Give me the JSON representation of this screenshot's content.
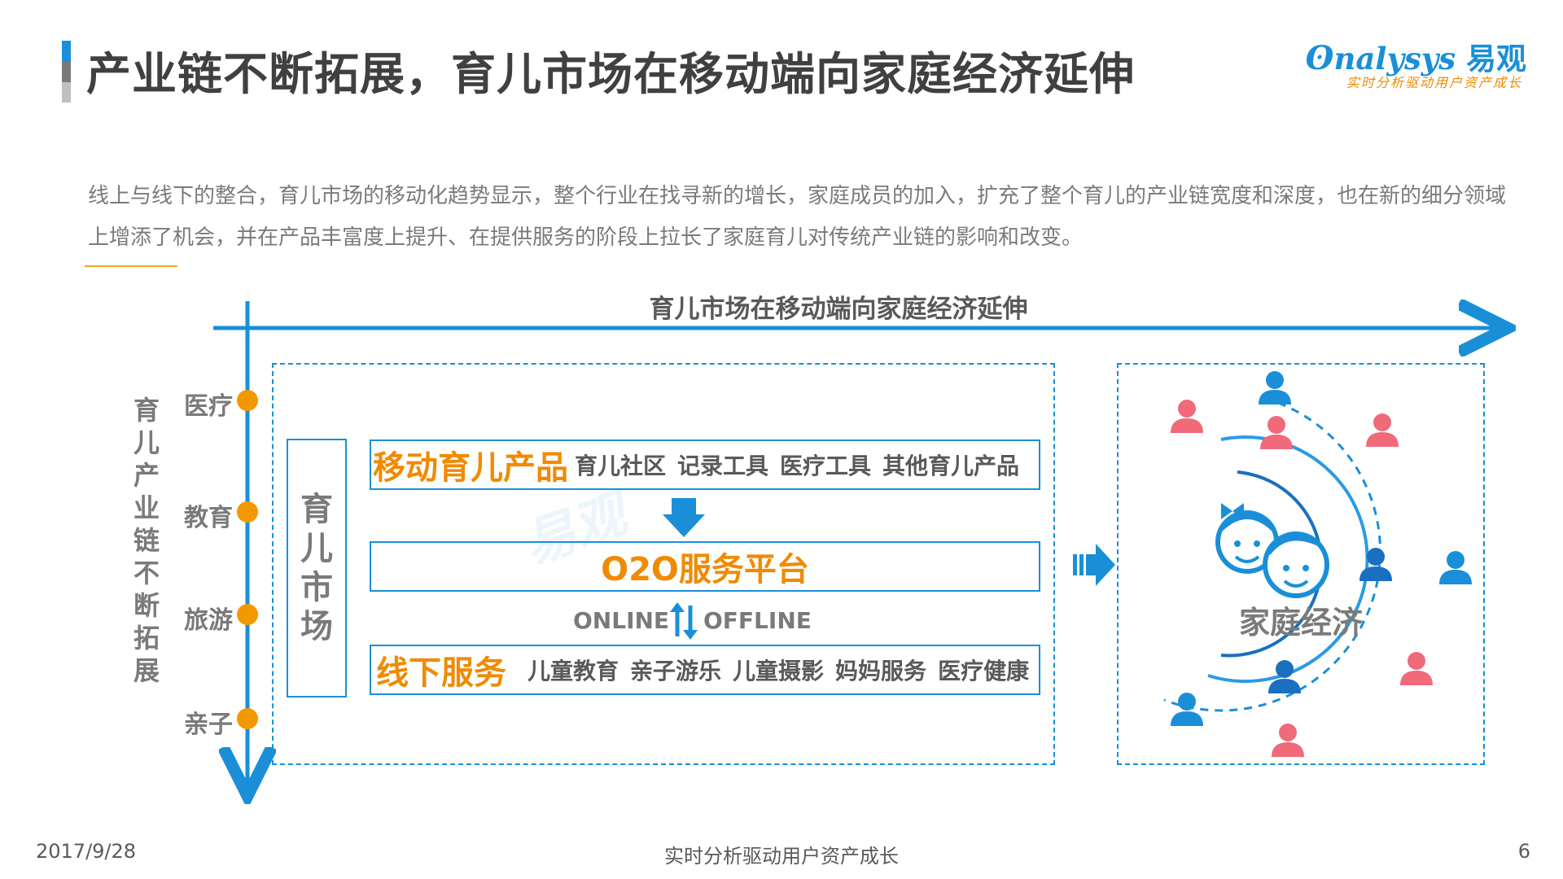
{
  "header": {
    "title": "产业链不断拓展，育儿市场在移动端向家庭经济延伸",
    "logo_en": "nalysys",
    "logo_cn": "易观",
    "logo_slogan": "实时分析驱动用户资产成长"
  },
  "intro": {
    "text": "线上与线下的整合，育儿市场的移动化趋势显示，整个行业在找寻新的增长，家庭成员的加入，扩充了整个育儿的产业链宽度和深度，也在新的细分领域上增添了机会，并在产品丰富度上提升、在提供服务的阶段上拉长了家庭育儿对传统产业链的影响和改变。"
  },
  "diagram": {
    "h_axis_title": "育儿市场在移动端向家庭经济延伸",
    "v_axis_title": "育儿产业链不断拓展",
    "industries": [
      "医疗",
      "教育",
      "旅游",
      "亲子"
    ],
    "market_label": "育儿市场",
    "rows": {
      "mobile": {
        "title": "移动育儿产品",
        "tags": [
          "育儿社区",
          "记录工具",
          "医疗工具",
          "其他育儿产品"
        ]
      },
      "o2o": {
        "title": "O2O服务平台"
      },
      "offline": {
        "title": "线下服务",
        "tags": [
          "儿童教育",
          "亲子游乐",
          "儿童摄影",
          "妈妈服务",
          "医疗健康"
        ]
      }
    },
    "online_label": "ONLINE",
    "offline_label": "OFFLINE",
    "family_label": "家庭经济"
  },
  "footer": {
    "date": "2017/9/28",
    "slogan": "实时分析驱动用户资产成长",
    "page": "6"
  },
  "colors": {
    "accent_blue": "#1a8fd8",
    "accent_orange": "#f08a00",
    "person_pink": "#f06a7a",
    "person_blue": "#1a8fd8"
  }
}
